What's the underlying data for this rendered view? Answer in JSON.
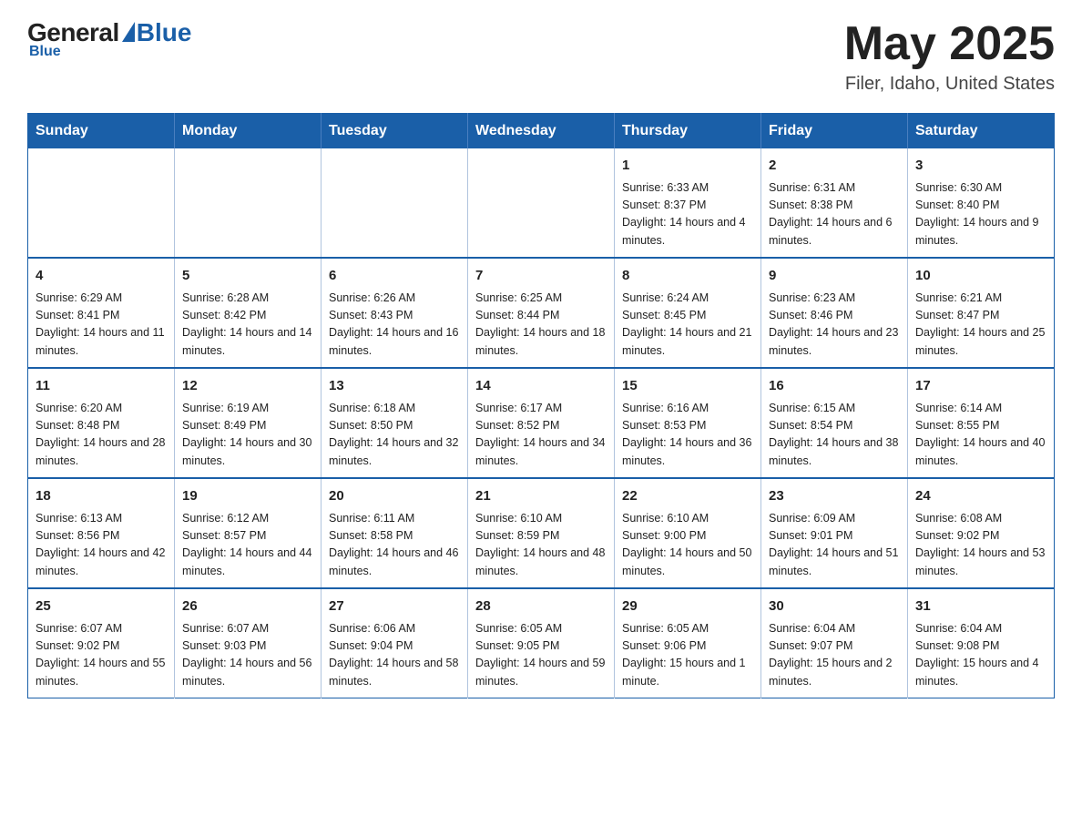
{
  "header": {
    "logo_general": "General",
    "logo_blue": "Blue",
    "title": "May 2025",
    "location": "Filer, Idaho, United States"
  },
  "calendar": {
    "days_of_week": [
      "Sunday",
      "Monday",
      "Tuesday",
      "Wednesday",
      "Thursday",
      "Friday",
      "Saturday"
    ],
    "weeks": [
      [
        {
          "day": "",
          "info": ""
        },
        {
          "day": "",
          "info": ""
        },
        {
          "day": "",
          "info": ""
        },
        {
          "day": "",
          "info": ""
        },
        {
          "day": "1",
          "info": "Sunrise: 6:33 AM\nSunset: 8:37 PM\nDaylight: 14 hours and 4 minutes."
        },
        {
          "day": "2",
          "info": "Sunrise: 6:31 AM\nSunset: 8:38 PM\nDaylight: 14 hours and 6 minutes."
        },
        {
          "day": "3",
          "info": "Sunrise: 6:30 AM\nSunset: 8:40 PM\nDaylight: 14 hours and 9 minutes."
        }
      ],
      [
        {
          "day": "4",
          "info": "Sunrise: 6:29 AM\nSunset: 8:41 PM\nDaylight: 14 hours and 11 minutes."
        },
        {
          "day": "5",
          "info": "Sunrise: 6:28 AM\nSunset: 8:42 PM\nDaylight: 14 hours and 14 minutes."
        },
        {
          "day": "6",
          "info": "Sunrise: 6:26 AM\nSunset: 8:43 PM\nDaylight: 14 hours and 16 minutes."
        },
        {
          "day": "7",
          "info": "Sunrise: 6:25 AM\nSunset: 8:44 PM\nDaylight: 14 hours and 18 minutes."
        },
        {
          "day": "8",
          "info": "Sunrise: 6:24 AM\nSunset: 8:45 PM\nDaylight: 14 hours and 21 minutes."
        },
        {
          "day": "9",
          "info": "Sunrise: 6:23 AM\nSunset: 8:46 PM\nDaylight: 14 hours and 23 minutes."
        },
        {
          "day": "10",
          "info": "Sunrise: 6:21 AM\nSunset: 8:47 PM\nDaylight: 14 hours and 25 minutes."
        }
      ],
      [
        {
          "day": "11",
          "info": "Sunrise: 6:20 AM\nSunset: 8:48 PM\nDaylight: 14 hours and 28 minutes."
        },
        {
          "day": "12",
          "info": "Sunrise: 6:19 AM\nSunset: 8:49 PM\nDaylight: 14 hours and 30 minutes."
        },
        {
          "day": "13",
          "info": "Sunrise: 6:18 AM\nSunset: 8:50 PM\nDaylight: 14 hours and 32 minutes."
        },
        {
          "day": "14",
          "info": "Sunrise: 6:17 AM\nSunset: 8:52 PM\nDaylight: 14 hours and 34 minutes."
        },
        {
          "day": "15",
          "info": "Sunrise: 6:16 AM\nSunset: 8:53 PM\nDaylight: 14 hours and 36 minutes."
        },
        {
          "day": "16",
          "info": "Sunrise: 6:15 AM\nSunset: 8:54 PM\nDaylight: 14 hours and 38 minutes."
        },
        {
          "day": "17",
          "info": "Sunrise: 6:14 AM\nSunset: 8:55 PM\nDaylight: 14 hours and 40 minutes."
        }
      ],
      [
        {
          "day": "18",
          "info": "Sunrise: 6:13 AM\nSunset: 8:56 PM\nDaylight: 14 hours and 42 minutes."
        },
        {
          "day": "19",
          "info": "Sunrise: 6:12 AM\nSunset: 8:57 PM\nDaylight: 14 hours and 44 minutes."
        },
        {
          "day": "20",
          "info": "Sunrise: 6:11 AM\nSunset: 8:58 PM\nDaylight: 14 hours and 46 minutes."
        },
        {
          "day": "21",
          "info": "Sunrise: 6:10 AM\nSunset: 8:59 PM\nDaylight: 14 hours and 48 minutes."
        },
        {
          "day": "22",
          "info": "Sunrise: 6:10 AM\nSunset: 9:00 PM\nDaylight: 14 hours and 50 minutes."
        },
        {
          "day": "23",
          "info": "Sunrise: 6:09 AM\nSunset: 9:01 PM\nDaylight: 14 hours and 51 minutes."
        },
        {
          "day": "24",
          "info": "Sunrise: 6:08 AM\nSunset: 9:02 PM\nDaylight: 14 hours and 53 minutes."
        }
      ],
      [
        {
          "day": "25",
          "info": "Sunrise: 6:07 AM\nSunset: 9:02 PM\nDaylight: 14 hours and 55 minutes."
        },
        {
          "day": "26",
          "info": "Sunrise: 6:07 AM\nSunset: 9:03 PM\nDaylight: 14 hours and 56 minutes."
        },
        {
          "day": "27",
          "info": "Sunrise: 6:06 AM\nSunset: 9:04 PM\nDaylight: 14 hours and 58 minutes."
        },
        {
          "day": "28",
          "info": "Sunrise: 6:05 AM\nSunset: 9:05 PM\nDaylight: 14 hours and 59 minutes."
        },
        {
          "day": "29",
          "info": "Sunrise: 6:05 AM\nSunset: 9:06 PM\nDaylight: 15 hours and 1 minute."
        },
        {
          "day": "30",
          "info": "Sunrise: 6:04 AM\nSunset: 9:07 PM\nDaylight: 15 hours and 2 minutes."
        },
        {
          "day": "31",
          "info": "Sunrise: 6:04 AM\nSunset: 9:08 PM\nDaylight: 15 hours and 4 minutes."
        }
      ]
    ]
  }
}
